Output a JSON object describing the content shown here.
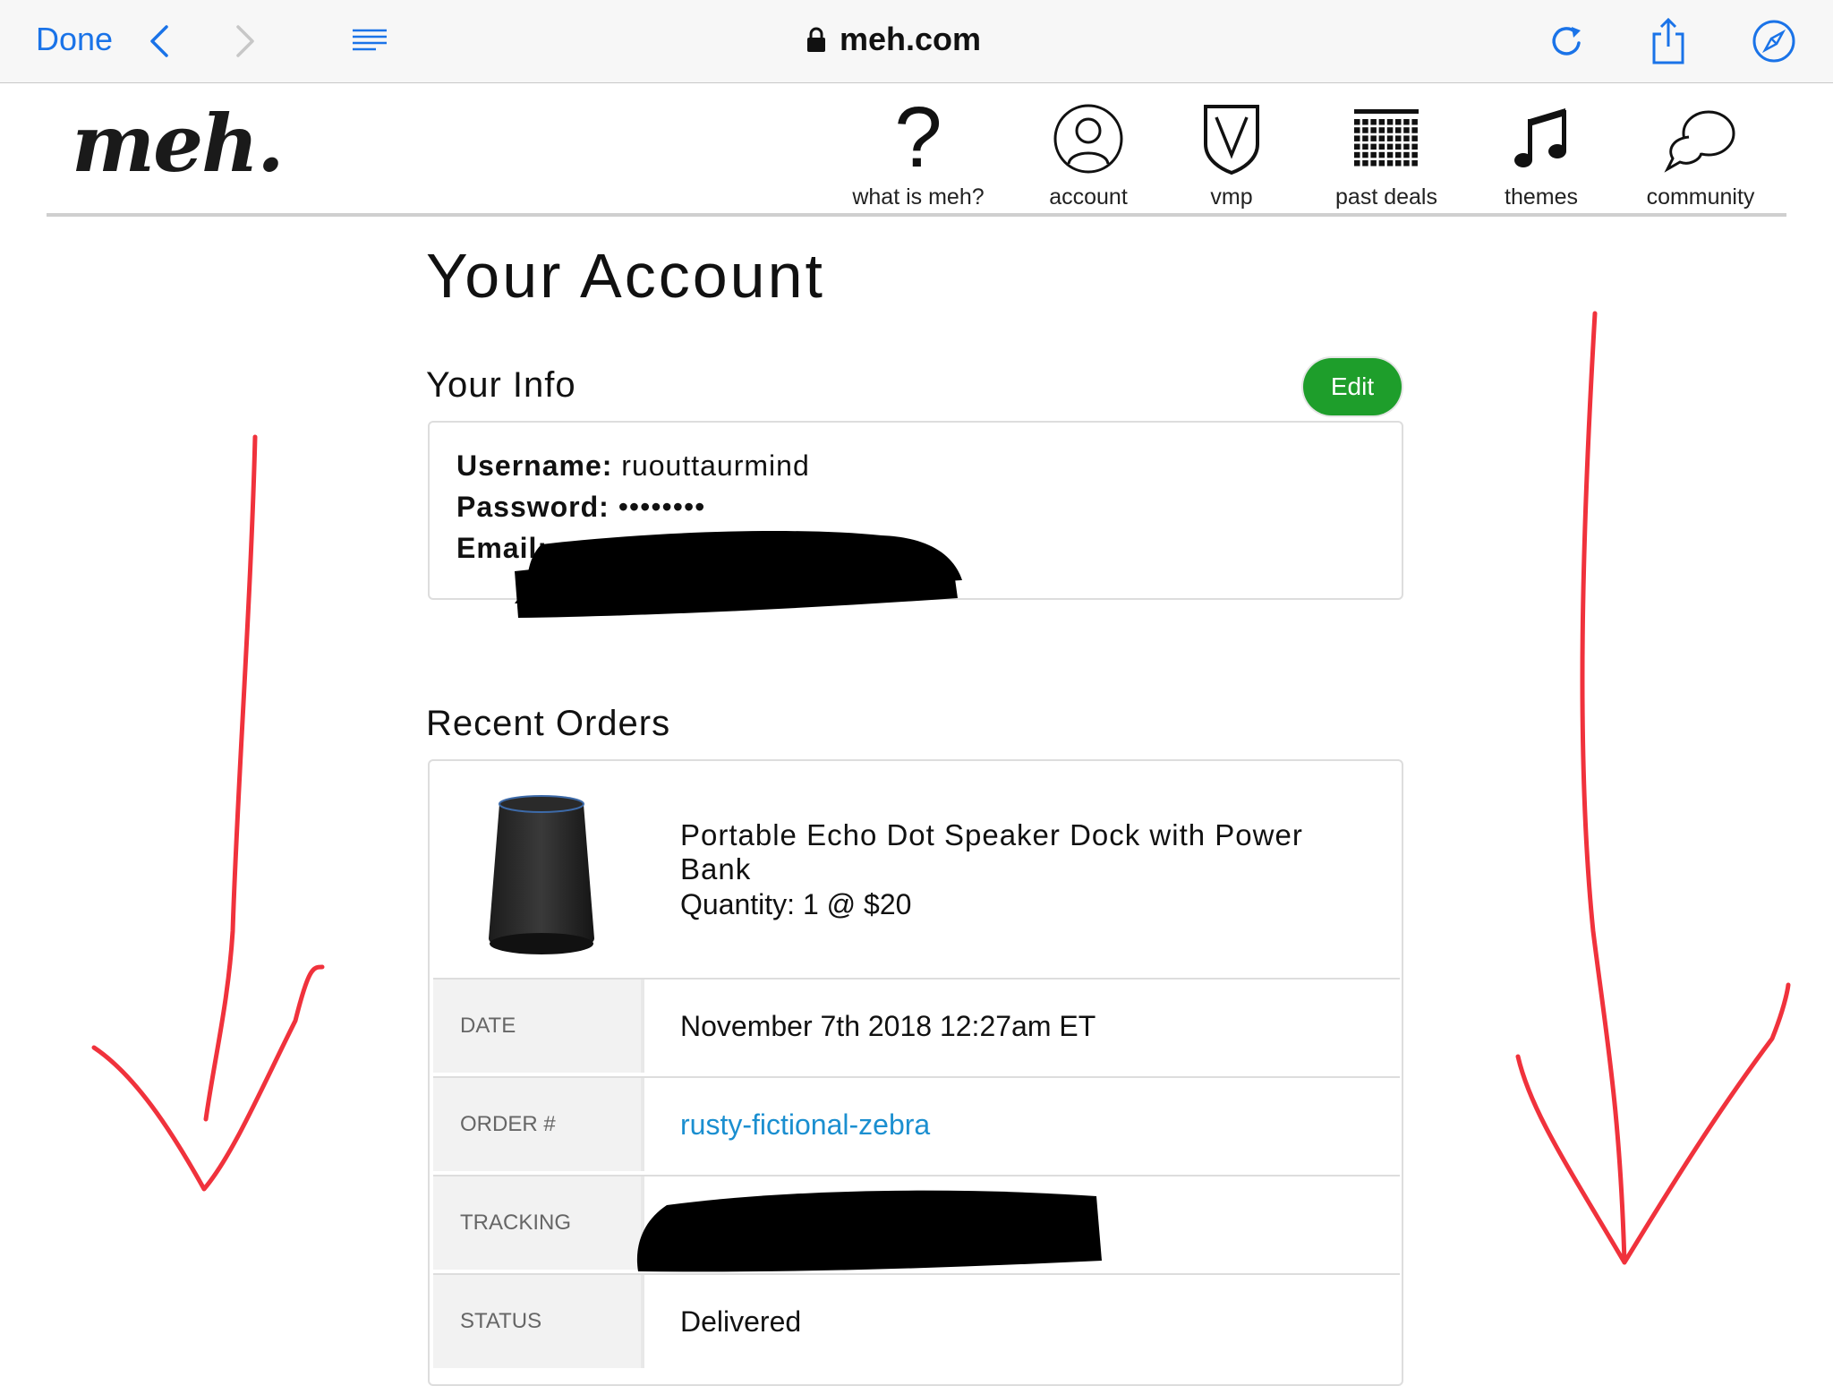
{
  "browser": {
    "done_label": "Done",
    "url": "meh.com"
  },
  "site": {
    "logo": "meh.",
    "nav": [
      {
        "label": "what is meh?",
        "icon": "question-icon"
      },
      {
        "label": "account",
        "icon": "account-icon"
      },
      {
        "label": "vmp",
        "icon": "vmp-shield-icon"
      },
      {
        "label": "past deals",
        "icon": "calendar-grid-icon"
      },
      {
        "label": "themes",
        "icon": "music-note-icon"
      },
      {
        "label": "community",
        "icon": "chat-bubbles-icon"
      }
    ]
  },
  "page": {
    "title": "Your Account"
  },
  "your_info": {
    "heading": "Your Info",
    "edit_label": "Edit",
    "username_label": "Username:",
    "username_value": "ruouttaurmind",
    "password_label": "Password:",
    "password_value": "••••••••",
    "email_label": "Email:"
  },
  "recent_orders": {
    "heading": "Recent Orders",
    "product_title": "Portable Echo Dot Speaker Dock with Power Bank",
    "quantity": "Quantity: 1 @ $20",
    "rows": [
      {
        "label": "DATE",
        "value": "November 7th 2018 12:27am ET"
      },
      {
        "label": "ORDER #",
        "value": "rusty-fictional-zebra"
      },
      {
        "label": "TRACKING",
        "value": ""
      },
      {
        "label": "STATUS",
        "value": "Delivered"
      }
    ]
  },
  "colors": {
    "link_blue": "#1b8fd0",
    "safari_blue": "#1a73e8",
    "edit_green": "#1e9e2b",
    "annotation_red": "#f0323c"
  }
}
